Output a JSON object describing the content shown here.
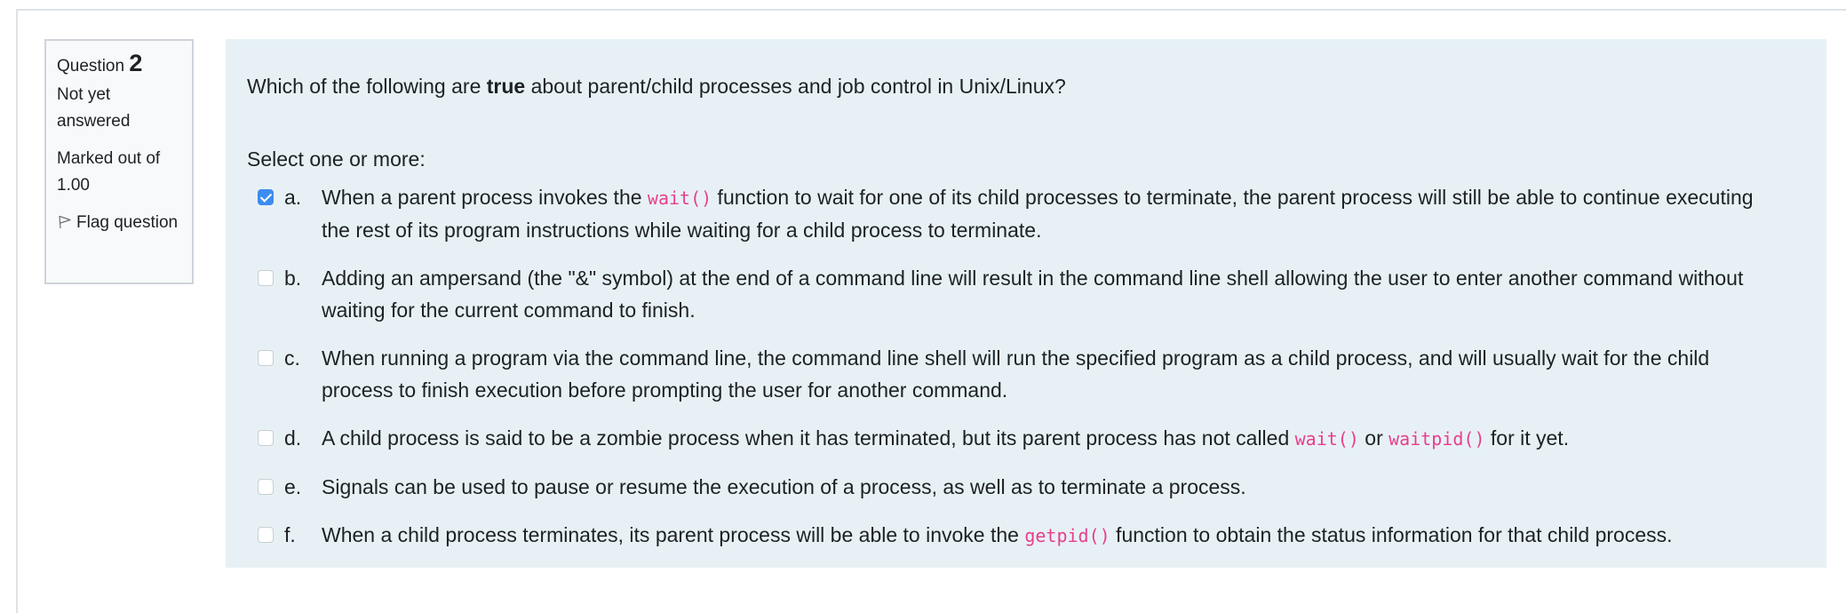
{
  "question_info": {
    "question_label": "Question",
    "question_number": "2",
    "state": "Not yet answered",
    "grade": "Marked out of 1.00",
    "flag_label": "Flag question",
    "flag_icon": "flag-outline-icon"
  },
  "question": {
    "text_before": "Which of the following are ",
    "text_bold": "true",
    "text_after": " about parent/child processes and job control in Unix/Linux?",
    "prompt": "Select one or more:"
  },
  "answers": [
    {
      "letter": "a.",
      "checked": true,
      "segments": [
        {
          "t": "When a parent process invokes the "
        },
        {
          "code": "wait()"
        },
        {
          "t": " function to wait for one of its child processes to terminate, the parent process will still be able to continue executing the rest of its program instructions while waiting for a child process to terminate."
        }
      ]
    },
    {
      "letter": "b.",
      "checked": false,
      "segments": [
        {
          "t": "Adding an ampersand (the \"&\" symbol) at the end of a command line will result in the command line shell allowing the user to enter another command without waiting for the current command to finish."
        }
      ]
    },
    {
      "letter": "c.",
      "checked": false,
      "segments": [
        {
          "t": "When running a program via the command line, the command line shell will run the specified program as a child process, and will usually wait for the child process to finish execution before prompting the user for another command."
        }
      ]
    },
    {
      "letter": "d.",
      "checked": false,
      "segments": [
        {
          "t": "A child process is said to be a zombie process when it has terminated, but its parent process has not called "
        },
        {
          "code": "wait()"
        },
        {
          "t": " or "
        },
        {
          "code": "waitpid()"
        },
        {
          "t": " for it yet."
        }
      ]
    },
    {
      "letter": "e.",
      "checked": false,
      "segments": [
        {
          "t": "Signals can be used to pause or resume the execution of a process, as well as to terminate a process."
        }
      ]
    },
    {
      "letter": "f.",
      "checked": false,
      "segments": [
        {
          "t": "When a child process terminates, its parent process will be able to invoke the "
        },
        {
          "code": "getpid()"
        },
        {
          "t": " function to obtain the status information for that child process."
        }
      ]
    }
  ],
  "colors": {
    "content_bg": "#e7f1f5",
    "info_bg": "#f8f9fa",
    "code_color": "#e83e8c",
    "checkbox_checked": "#3d8cf0"
  }
}
